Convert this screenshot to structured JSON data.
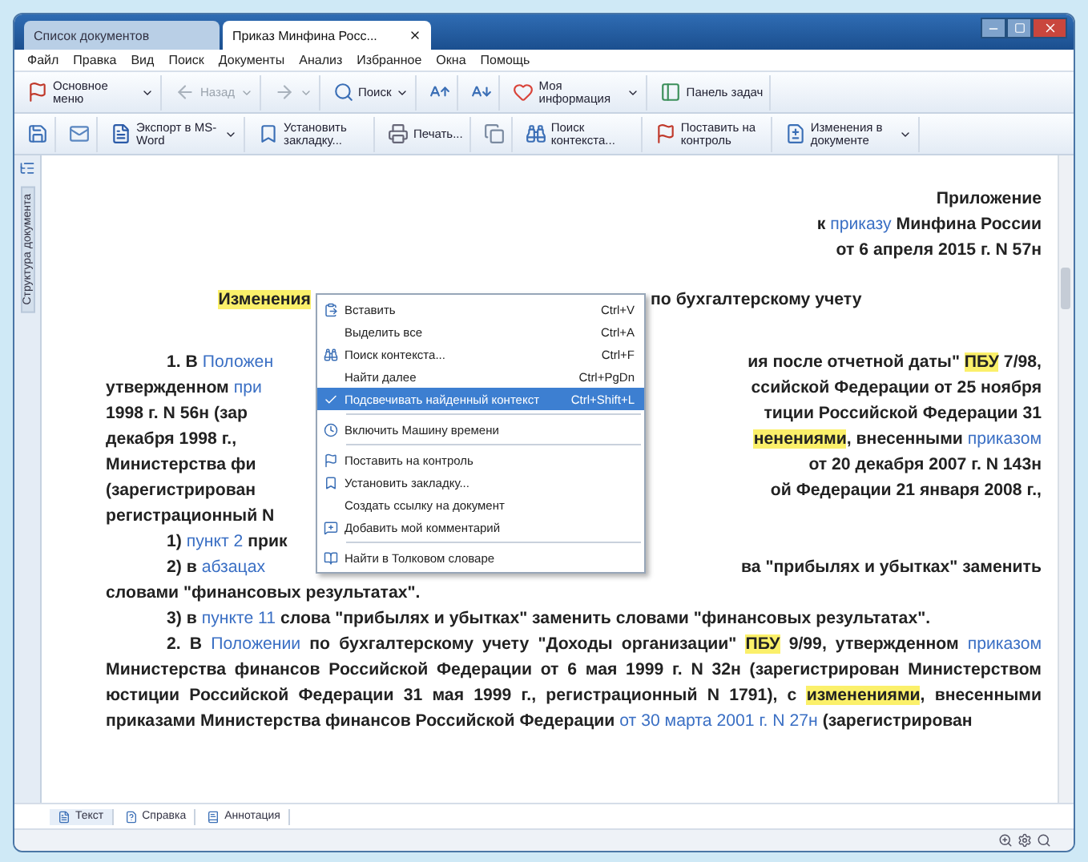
{
  "window": {
    "tabs": [
      {
        "label": "Список документов",
        "selected": false,
        "closable": false
      },
      {
        "label": "Приказ Минфина Росс...",
        "selected": true,
        "closable": true
      }
    ]
  },
  "menu_bar": [
    "Файл",
    "Правка",
    "Вид",
    "Поиск",
    "Документы",
    "Анализ",
    "Избранное",
    "Окна",
    "Помощь"
  ],
  "toolbar_1": [
    {
      "label": "Основное меню",
      "dropdown": true,
      "disabled": false
    },
    {
      "label": "Назад",
      "dropdown": true,
      "disabled": true
    },
    {
      "dropdown": true,
      "disabled": true
    },
    {
      "label": "Поиск",
      "dropdown": true,
      "disabled": false
    },
    {
      "dropdown": false,
      "disabled": false
    },
    {
      "dropdown": false,
      "disabled": false
    },
    {
      "label": "Моя информация",
      "dropdown": true,
      "disabled": false
    },
    {
      "label": "Панель задач",
      "dropdown": false,
      "disabled": false
    }
  ],
  "toolbar_2": [
    {
      "dropdown": false,
      "disabled": false
    },
    {
      "dropdown": false,
      "disabled": false
    },
    {
      "label": "Экспорт в MS-Word",
      "dropdown": true,
      "disabled": false
    },
    {
      "label": "Установить закладку...",
      "dropdown": false,
      "disabled": false
    },
    {
      "label": "Печать...",
      "dropdown": false,
      "disabled": false
    },
    {
      "dropdown": false,
      "disabled": false
    },
    {
      "label": "Поиск контекста...",
      "dropdown": false,
      "disabled": false
    },
    {
      "label": "Поставить на контроль",
      "dropdown": false,
      "disabled": false
    },
    {
      "label": "Изменения в документе",
      "dropdown": true,
      "disabled": false
    }
  ],
  "sidebar": {
    "label": "Структура документа"
  },
  "document": [
    {
      "kind": "right",
      "segments": [
        {
          "kind": "text",
          "text": "Приложение"
        }
      ]
    },
    {
      "kind": "right",
      "segments": [
        {
          "kind": "text",
          "text": "к "
        },
        {
          "kind": "link",
          "text": "приказу"
        },
        {
          "kind": "text",
          "text": " Минфина России"
        }
      ]
    },
    {
      "kind": "right",
      "segments": [
        {
          "kind": "text",
          "text": "от 6 апреля 2015 г. N 57н"
        }
      ]
    },
    {
      "kind": "heading",
      "left": [
        {
          "kind": "hl",
          "text": "Изменения"
        }
      ],
      "right": [
        {
          "kind": "text",
          "text": "по бухгалтерскому учету"
        }
      ]
    },
    {
      "kind": "split_indented",
      "left": [
        {
          "kind": "text",
          "text": "1. В "
        },
        {
          "kind": "link",
          "text": "Положен"
        }
      ],
      "right": [
        {
          "kind": "text",
          "text": "ия после отчетной даты\" "
        },
        {
          "kind": "hl",
          "text": "ПБУ"
        },
        {
          "kind": "text",
          "text": " 7/98,"
        }
      ]
    },
    {
      "kind": "split",
      "left": [
        {
          "kind": "text",
          "text": "утвержденном "
        },
        {
          "kind": "link",
          "text": "при"
        }
      ],
      "right": [
        {
          "kind": "text",
          "text": "ссийской Федерации от 25 ноября"
        }
      ]
    },
    {
      "kind": "split",
      "left": [
        {
          "kind": "text",
          "text": "1998 г. N 56н (зар"
        }
      ],
      "right": [
        {
          "kind": "text",
          "text": "тиции Российской Федерации 31"
        }
      ]
    },
    {
      "kind": "split",
      "left": [
        {
          "kind": "text",
          "text": "декабря 1998 г.,"
        }
      ],
      "right": [
        {
          "kind": "hl",
          "text": "ненениями"
        },
        {
          "kind": "text",
          "text": ", внесенными "
        },
        {
          "kind": "link",
          "text": "приказом"
        }
      ]
    },
    {
      "kind": "split",
      "left": [
        {
          "kind": "text",
          "text": "Министерства фи"
        }
      ],
      "right": [
        {
          "kind": "text",
          "text": "от 20 декабря 2007 г. N 143н"
        }
      ]
    },
    {
      "kind": "split",
      "left": [
        {
          "kind": "text",
          "text": "(зарегистрирован"
        }
      ],
      "right": [
        {
          "kind": "text",
          "text": "ой Федерации 21 января 2008 г.,"
        }
      ]
    },
    {
      "kind": "split",
      "left": [
        {
          "kind": "text",
          "text": "регистрационный N"
        }
      ]
    },
    {
      "kind": "split_indented",
      "left": [
        {
          "kind": "text",
          "text": "1) "
        },
        {
          "kind": "link",
          "text": "пункт 2"
        },
        {
          "kind": "text",
          "text": " прик"
        }
      ]
    },
    {
      "kind": "split_indented",
      "left": [
        {
          "kind": "text",
          "text": "2) в "
        },
        {
          "kind": "link",
          "text": "абзацах"
        }
      ],
      "right": [
        {
          "kind": "text",
          "text": "ва \"прибылях и убытках\" заменить"
        }
      ]
    },
    {
      "kind": "para",
      "indent": false,
      "segments": [
        {
          "kind": "text",
          "text": "словами \"финансовых результатах\"."
        }
      ]
    },
    {
      "kind": "para",
      "indent": true,
      "segments": [
        {
          "kind": "text",
          "text": "3) в "
        },
        {
          "kind": "link",
          "text": "пункте 11"
        },
        {
          "kind": "text",
          "text": " слова \"прибылях и убытках\" заменить словами \"финансовых результатах\"."
        }
      ]
    },
    {
      "kind": "para",
      "indent": true,
      "segments": [
        {
          "kind": "text",
          "text": "2. В "
        },
        {
          "kind": "link",
          "text": "Положении"
        },
        {
          "kind": "text",
          "text": " по бухгалтерскому учету \"Доходы организации\" "
        },
        {
          "kind": "hl",
          "text": "ПБУ"
        },
        {
          "kind": "text",
          "text": " 9/99, утвержденном "
        },
        {
          "kind": "link",
          "text": "приказом"
        },
        {
          "kind": "text",
          "text": " Министерства финансов Российской Федерации от 6 мая 1999 г. N 32н (зарегистрирован Министерством юстиции Российской Федерации 31 мая 1999 г., регистрационный N 1791), с "
        },
        {
          "kind": "hl",
          "text": "изменениями"
        },
        {
          "kind": "text",
          "text": ", внесенными приказами Министерства финансов Российской Федерации "
        },
        {
          "kind": "link",
          "text": "от 30 марта 2001 г. N 27н"
        },
        {
          "kind": "text",
          "text": " (зарегистрирован"
        }
      ]
    }
  ],
  "context_menu": [
    {
      "kind": "item",
      "label": "Вставить",
      "shortcut": "Ctrl+V",
      "selected": false,
      "checked": false
    },
    {
      "kind": "item",
      "label": "Выделить все",
      "shortcut": "Ctrl+A",
      "selected": false,
      "checked": false
    },
    {
      "kind": "item",
      "label": "Поиск контекста...",
      "shortcut": "Ctrl+F",
      "selected": false,
      "checked": false
    },
    {
      "kind": "item",
      "label": "Найти далее",
      "shortcut": "Ctrl+PgDn",
      "selected": false,
      "checked": false
    },
    {
      "kind": "item",
      "label": "Подсвечивать найденный контекст",
      "shortcut": "Ctrl+Shift+L",
      "selected": true,
      "checked": true
    },
    {
      "kind": "separator"
    },
    {
      "kind": "item",
      "label": "Включить Машину времени",
      "selected": false,
      "checked": false
    },
    {
      "kind": "separator"
    },
    {
      "kind": "item",
      "label": "Поставить на контроль",
      "selected": false,
      "checked": false
    },
    {
      "kind": "item",
      "label": "Установить закладку...",
      "selected": false,
      "checked": false
    },
    {
      "kind": "item",
      "label": "Создать ссылку на документ",
      "selected": false,
      "checked": false
    },
    {
      "kind": "item",
      "label": "Добавить мой комментарий",
      "selected": false,
      "checked": false
    },
    {
      "kind": "separator"
    },
    {
      "kind": "item",
      "label": "Найти в Толковом словаре",
      "selected": false,
      "checked": false
    }
  ],
  "bottom_tabs": [
    {
      "label": "Текст",
      "selected": true
    },
    {
      "label": "Справка",
      "selected": false
    },
    {
      "label": "Аннотация",
      "selected": false
    }
  ]
}
